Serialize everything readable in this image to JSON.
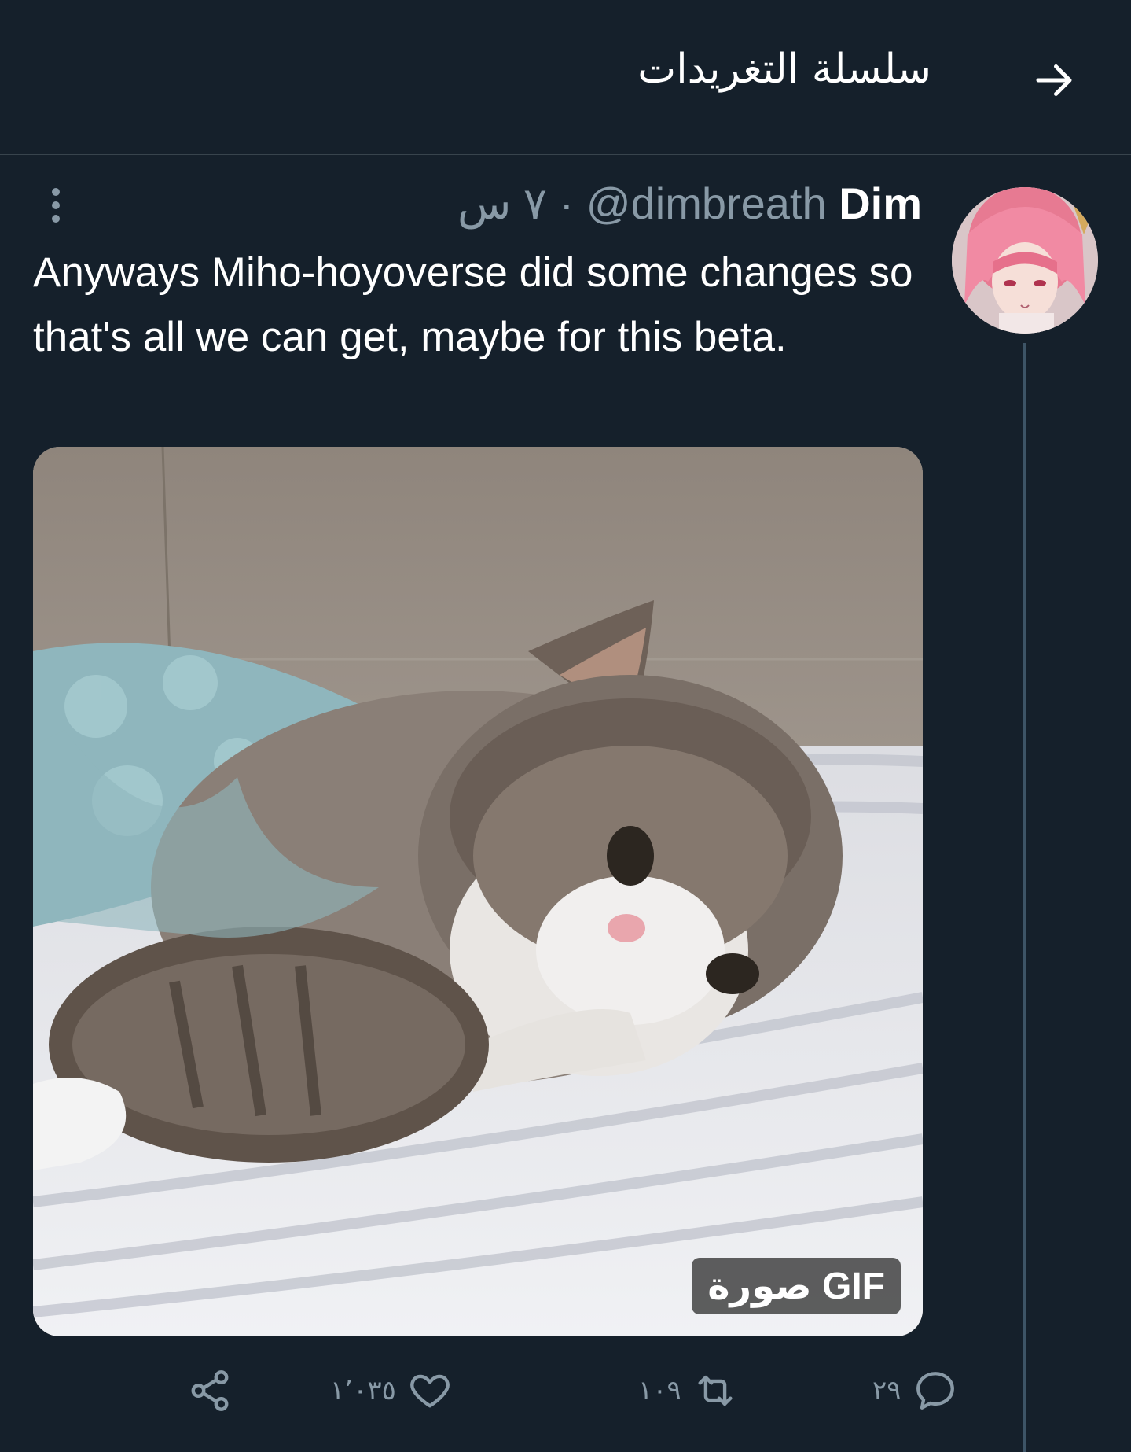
{
  "header": {
    "title": "سلسلة التغريدات",
    "back_icon": "arrow-right-icon"
  },
  "tweet": {
    "display_name": "Dim",
    "handle": "@dimbreath",
    "separator": "·",
    "time": "٧ س",
    "text": "Anyways Miho-hoyoverse did some changes so that's all we can get, maybe for this beta.",
    "media_badge": "صورة GIF",
    "more_icon": "more-vertical-icon"
  },
  "actions": {
    "reply_count": "٢٩",
    "retweet_count": "١٠٩",
    "like_count": "١٬٠٣٥",
    "reply_icon": "reply-icon",
    "retweet_icon": "retweet-icon",
    "like_icon": "heart-icon",
    "share_icon": "share-icon"
  },
  "colors": {
    "background": "#15202b",
    "secondary_text": "#8899a6",
    "divider": "#38444d"
  }
}
